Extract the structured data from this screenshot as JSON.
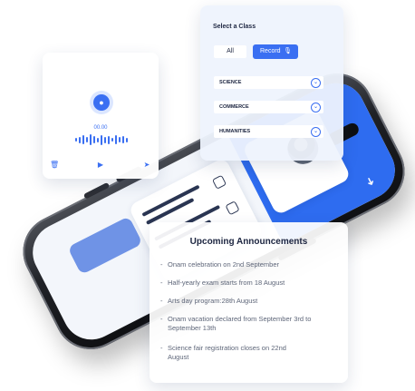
{
  "voice_recorder": {
    "timer": "00.00",
    "mic_icon": "microphone-icon",
    "delete_icon": "trash-icon",
    "play_icon": "play-icon",
    "send_icon": "send-icon"
  },
  "select_class": {
    "title": "Select a Class",
    "tabs": {
      "all": "All",
      "record": "Record"
    },
    "record_icon": "microphone-icon",
    "options": [
      "SCIENCE",
      "COMMERCE",
      "HUMANITIES"
    ],
    "chevron_icon": "chevron-down-icon"
  },
  "announcements": {
    "title": "Upcoming Announcements",
    "items": [
      "Onam celebration on 2nd September",
      "Half-yearly exam starts from 18 August",
      "Arts day program:28th August",
      "Onam vacation declared from September 3rd to September 13th",
      "Science fair registration closes on 22nd August"
    ]
  },
  "phone": {
    "accent_color": "#2e6cf0"
  },
  "colors": {
    "accent": "#3a6ff2",
    "card_bg": "#ffffff",
    "panel_bg": "#eef3fd",
    "heading": "#1c2540"
  }
}
